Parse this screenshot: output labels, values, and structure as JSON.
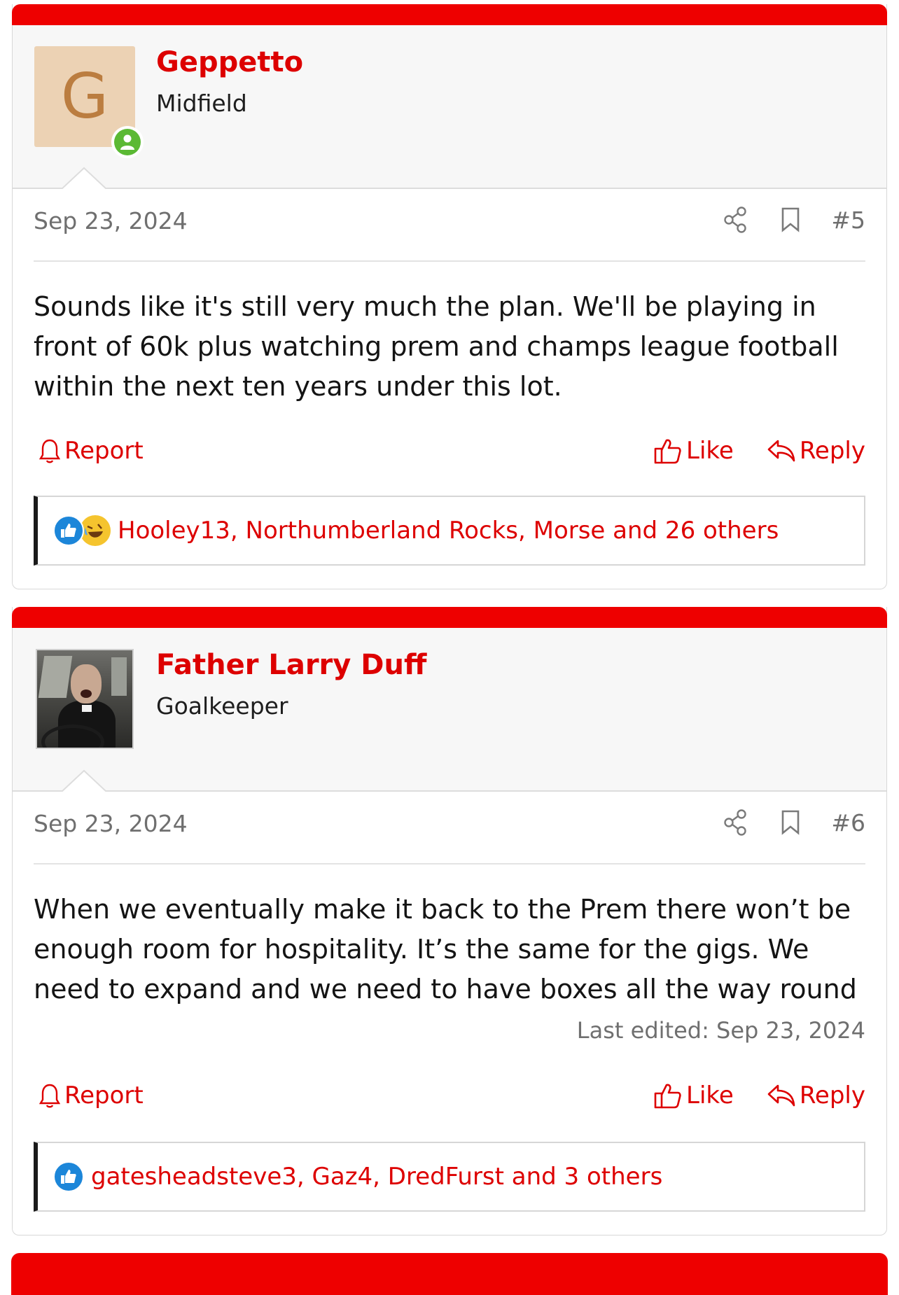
{
  "colors": {
    "brand_bar": "#ee0000",
    "link_red": "#dd0000",
    "online_green": "#5bb934",
    "like_blue": "#1c86d9"
  },
  "posts": [
    {
      "avatar_letter": "G",
      "avatar_type": "letter",
      "username": "Geppetto",
      "user_title": "Midfield",
      "online": true,
      "date": "Sep 23, 2024",
      "post_number": "#5",
      "message": "Sounds like it's still very much the plan. We'll be playing in front of 60k plus watching prem and champs league football within the next ten years under this lot.",
      "last_edited": null,
      "report_label": "Report",
      "like_label": "Like",
      "reply_label": "Reply",
      "reaction_icons": [
        "like-icon",
        "laugh-icon"
      ],
      "reactions_text": "Hooley13, Northumberland Rocks, Morse and 26 others"
    },
    {
      "avatar_type": "photo",
      "username": "Father Larry Duff",
      "user_title": "Goalkeeper",
      "online": false,
      "date": "Sep 23, 2024",
      "post_number": "#6",
      "message": "When we eventually make it back to the Prem there won’t be enough room for hospitality. It’s the same for the gigs. We need to expand and we need to have boxes all the way round",
      "last_edited": "Last edited: Sep 23, 2024",
      "report_label": "Report",
      "like_label": "Like",
      "reply_label": "Reply",
      "reaction_icons": [
        "like-icon"
      ],
      "reactions_text": "gatesheadsteve3, Gaz4, DredFurst and 3 others"
    }
  ]
}
